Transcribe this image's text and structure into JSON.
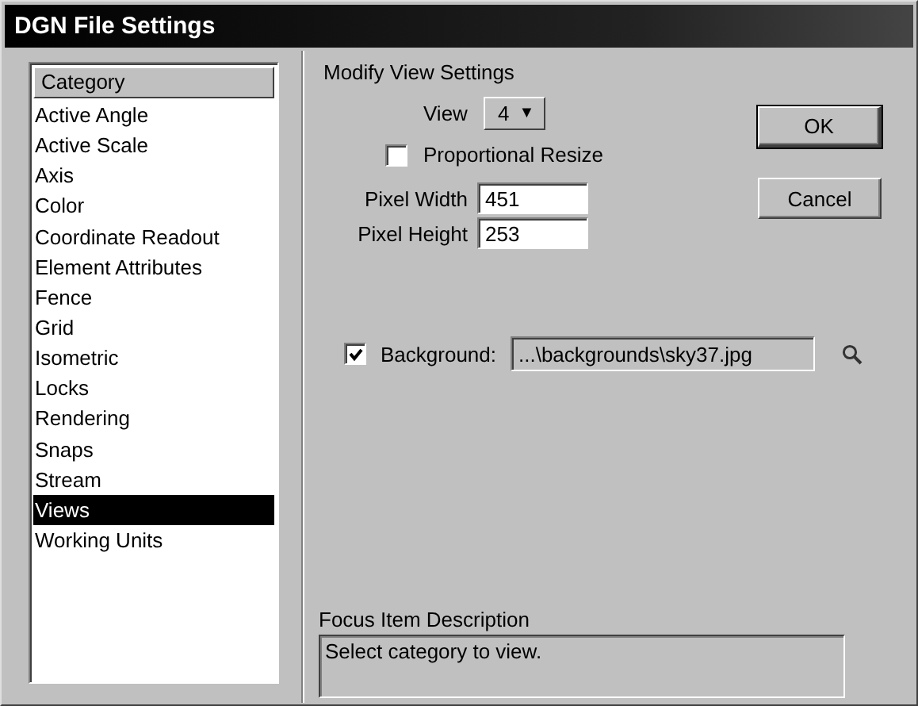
{
  "window": {
    "title": "DGN File Settings"
  },
  "category_list": {
    "header": "Category",
    "items": [
      {
        "label": "Active Angle",
        "selected": false
      },
      {
        "label": "Active Scale",
        "selected": false
      },
      {
        "label": "Axis",
        "selected": false
      },
      {
        "label": "Color",
        "selected": false
      },
      {
        "label": "Coordinate Readout",
        "selected": false
      },
      {
        "label": "Element Attributes",
        "selected": false
      },
      {
        "label": "Fence",
        "selected": false
      },
      {
        "label": "Grid",
        "selected": false
      },
      {
        "label": "Isometric",
        "selected": false
      },
      {
        "label": "Locks",
        "selected": false
      },
      {
        "label": "Rendering",
        "selected": false
      },
      {
        "label": "Snaps",
        "selected": false
      },
      {
        "label": "Stream",
        "selected": false
      },
      {
        "label": "Views",
        "selected": true
      },
      {
        "label": "Working Units",
        "selected": false
      }
    ]
  },
  "settings": {
    "heading": "Modify View Settings",
    "view": {
      "label": "View",
      "value": "4",
      "arrow": "▼"
    },
    "proportional_resize": {
      "label": "Proportional Resize",
      "checked": false
    },
    "pixel_width": {
      "label": "Pixel Width",
      "value": "451"
    },
    "pixel_height": {
      "label": "Pixel Height",
      "value": "253"
    },
    "background": {
      "label": "Background:",
      "checked": true,
      "value": "...\\backgrounds\\sky37.jpg"
    }
  },
  "buttons": [
    {
      "label": "OK",
      "default": true
    },
    {
      "label": "Cancel",
      "default": false
    }
  ],
  "focus_description": {
    "label": "Focus Item Description",
    "text": "Select category to view."
  }
}
